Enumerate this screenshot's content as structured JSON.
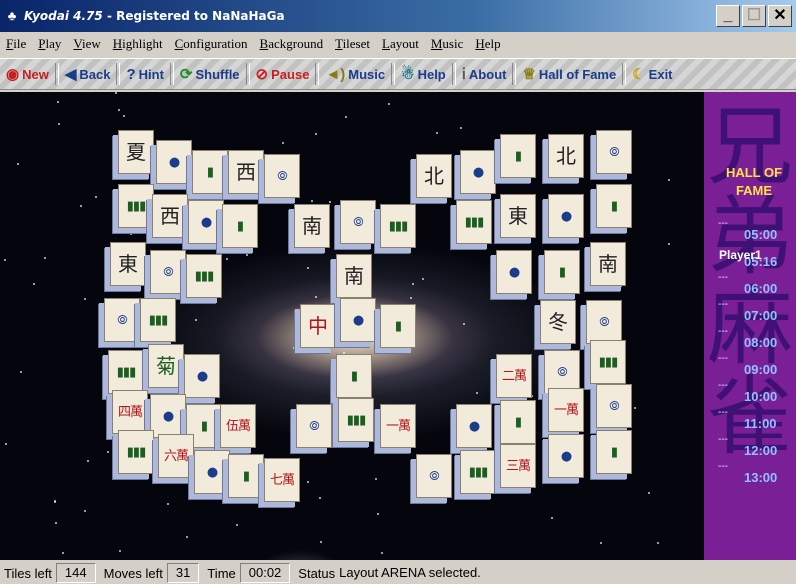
{
  "window": {
    "app_name": "Kyodai",
    "version": " 4.75",
    "registration": " - Registered to NaNaHaGa",
    "minimize": "_",
    "maximize": "☐",
    "close": "✕"
  },
  "menu": [
    "File",
    "Play",
    "View",
    "Highlight",
    "Configuration",
    "Background",
    "Tileset",
    "Layout",
    "Music",
    "Help"
  ],
  "toolbar": {
    "new": "New",
    "back": "Back",
    "hint": "Hint",
    "shuffle": "Shuffle",
    "pause": "Pause",
    "music": "Music",
    "help": "Help",
    "about": "About",
    "hall_of_fame": "Hall of Fame",
    "exit": "Exit"
  },
  "hall_of_fame": {
    "title_line1": "HALL OF",
    "title_line2": "FAME",
    "player": "Player1",
    "dash": "---",
    "times": [
      "05:00",
      "05:16",
      "06:00",
      "07:00",
      "08:00",
      "09:00",
      "10:00",
      "11:00",
      "12:00",
      "13:00"
    ],
    "side_chars": "兄弟麻雀"
  },
  "status": {
    "tiles_left_label": "Tiles left",
    "tiles_left": "144",
    "moves_left_label": "Moves left",
    "moves_left": "31",
    "time_label": "Time",
    "time": "00:02",
    "status_label": "Status",
    "status_text": "Layout ARENA selected."
  },
  "tiles": [
    {
      "g": "夏",
      "c": "black"
    },
    {
      "g": "西",
      "c": "black"
    },
    {
      "g": "西",
      "c": "black"
    },
    {
      "g": "南",
      "c": "black"
    },
    {
      "g": "北",
      "c": "black"
    },
    {
      "g": "北",
      "c": "black"
    },
    {
      "g": "東",
      "c": "black"
    },
    {
      "g": "東",
      "c": "black"
    },
    {
      "g": "南",
      "c": "black"
    },
    {
      "g": "南",
      "c": "black"
    },
    {
      "g": "中",
      "c": "red"
    },
    {
      "g": "冬",
      "c": "black"
    },
    {
      "g": "菊",
      "c": "green"
    },
    {
      "g": "二萬",
      "c": "red"
    },
    {
      "g": "四萬",
      "c": "red"
    },
    {
      "g": "伍萬",
      "c": "red"
    },
    {
      "g": "一萬",
      "c": "red"
    },
    {
      "g": "一萬",
      "c": "red"
    },
    {
      "g": "六萬",
      "c": "red"
    },
    {
      "g": "七萬",
      "c": "red"
    },
    {
      "g": "三萬",
      "c": "red"
    },
    {
      "g": "一萬",
      "c": "red"
    },
    {
      "g": "四萬",
      "c": "red"
    },
    {
      "g": "一萬",
      "c": "red"
    }
  ]
}
